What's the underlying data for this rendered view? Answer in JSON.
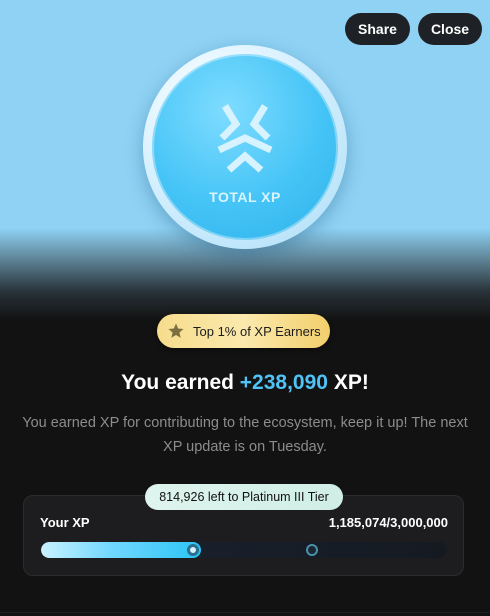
{
  "header": {
    "share_label": "Share",
    "close_label": "Close"
  },
  "coin": {
    "label": "TOTAL XP",
    "icon": "xp-logo-icon"
  },
  "badge": {
    "icon": "star-icon",
    "text": "Top 1% of XP Earners"
  },
  "headline": {
    "prefix": "You earned ",
    "amount": "+238,090",
    "suffix": " XP!"
  },
  "description": "You earned XP for contributing to the ecosystem, keep it up! The next XP update is on Tuesday.",
  "progress": {
    "remaining_text": "814,926 left to Platinum III Tier",
    "label": "Your XP",
    "count_text": "1,185,074/3,000,000",
    "current_xp": 1185074,
    "fill_fraction": 0.395,
    "milestone_fraction": 0.667
  },
  "colors": {
    "accent": "#4fc3f7",
    "badge_gold": "#f6dc8c",
    "background": "#121212",
    "sky": "#8fd2f4"
  }
}
